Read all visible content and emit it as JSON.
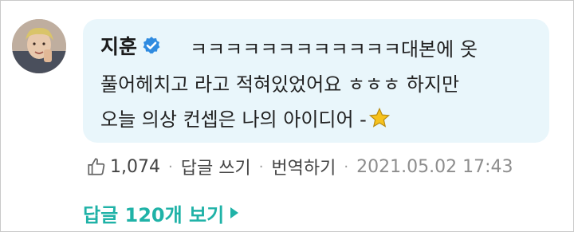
{
  "comment": {
    "author": "지훈",
    "verified_icon": "verified-check-icon",
    "lines": [
      "ㅋㅋㅋㅋㅋㅋㅋㅋㅋㅋㅋㅋ대본에 옷",
      "풀어헤치고 라고 적혀있었어요 ㅎㅎㅎ 하지만",
      "오늘 의상 컨셉은 나의 아이디어 -"
    ],
    "emoji": "star-icon"
  },
  "meta": {
    "like_icon": "thumbs-up-icon",
    "like_count": "1,074",
    "separator": "·",
    "reply_label": "답글 쓰기",
    "translate_label": "번역하기",
    "date": "2021.05.02 17:43"
  },
  "replies": {
    "label": "답글 120개 보기"
  },
  "colors": {
    "bubble_bg": "#e9f6fb",
    "accent": "#1fb2a7",
    "verified": "#2f8be0",
    "star": "#f6c21c"
  }
}
